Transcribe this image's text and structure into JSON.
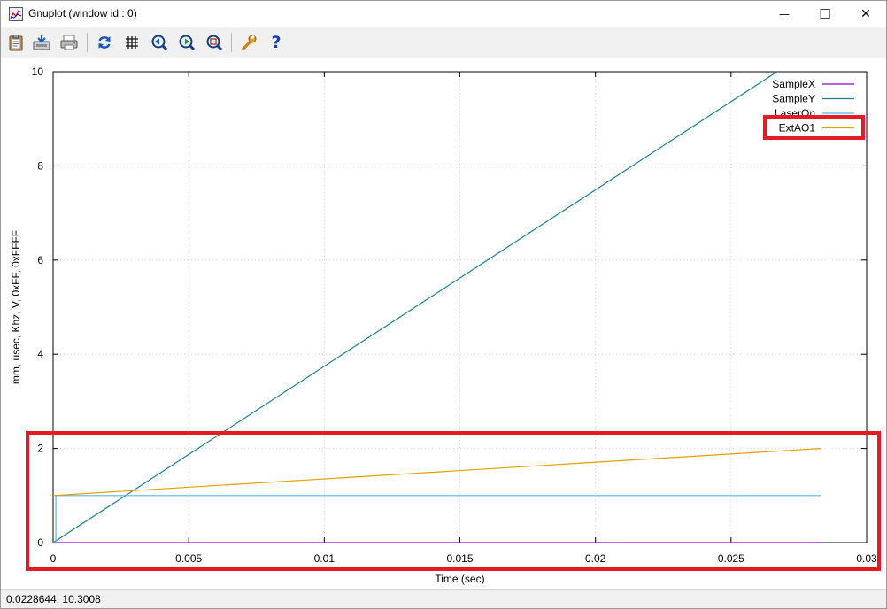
{
  "window": {
    "title": "Gnuplot (window id : 0)",
    "min_glyph": "—",
    "max_glyph": "☐",
    "close_glyph": "✕"
  },
  "toolbar": {
    "icons": [
      "clipboard-icon",
      "export-icon",
      "print-icon",
      "replot-icon",
      "grid-icon",
      "zoom-previous-icon",
      "zoom-next-icon",
      "autoscale-icon",
      "options-icon",
      "help-icon"
    ],
    "help_glyph": "?"
  },
  "status": {
    "coords": "0.0228644,  10.3008"
  },
  "colors": {
    "SampleX": "#9400d3",
    "SampleY": "#1a7f8e",
    "LaserOn": "#56b4e9",
    "ExtAO1": "#e69f00",
    "highlight": "#e31b23"
  },
  "chart_data": {
    "type": "line",
    "title": "",
    "xlabel": "Time (sec)",
    "ylabel": "mm, usec, Khz, V, 0xFF, 0xFFFF",
    "xlim": [
      0,
      0.03
    ],
    "ylim": [
      0,
      10
    ],
    "xticks": [
      0,
      0.005,
      0.01,
      0.015,
      0.02,
      0.025,
      0.03
    ],
    "xtick_labels": [
      "0",
      "0.005",
      "0.01",
      "0.015",
      "0.02",
      "0.025",
      "0.03"
    ],
    "yticks": [
      0,
      2,
      4,
      6,
      8,
      10
    ],
    "ytick_labels": [
      "0",
      "2",
      "4",
      "6",
      "8",
      "10"
    ],
    "grid": true,
    "legend": "top-right",
    "series": [
      {
        "name": "SampleX",
        "x": [
          0,
          0.0283
        ],
        "y": [
          0,
          0
        ]
      },
      {
        "name": "SampleY",
        "x": [
          0,
          0.0283
        ],
        "y": [
          0,
          10.6
        ]
      },
      {
        "name": "LaserOn",
        "x": [
          0,
          0.0001,
          0.0001,
          0.0283
        ],
        "y": [
          0,
          0,
          1,
          1
        ]
      },
      {
        "name": "ExtAO1",
        "x": [
          0,
          0.0283
        ],
        "y": [
          1,
          2
        ]
      }
    ]
  }
}
